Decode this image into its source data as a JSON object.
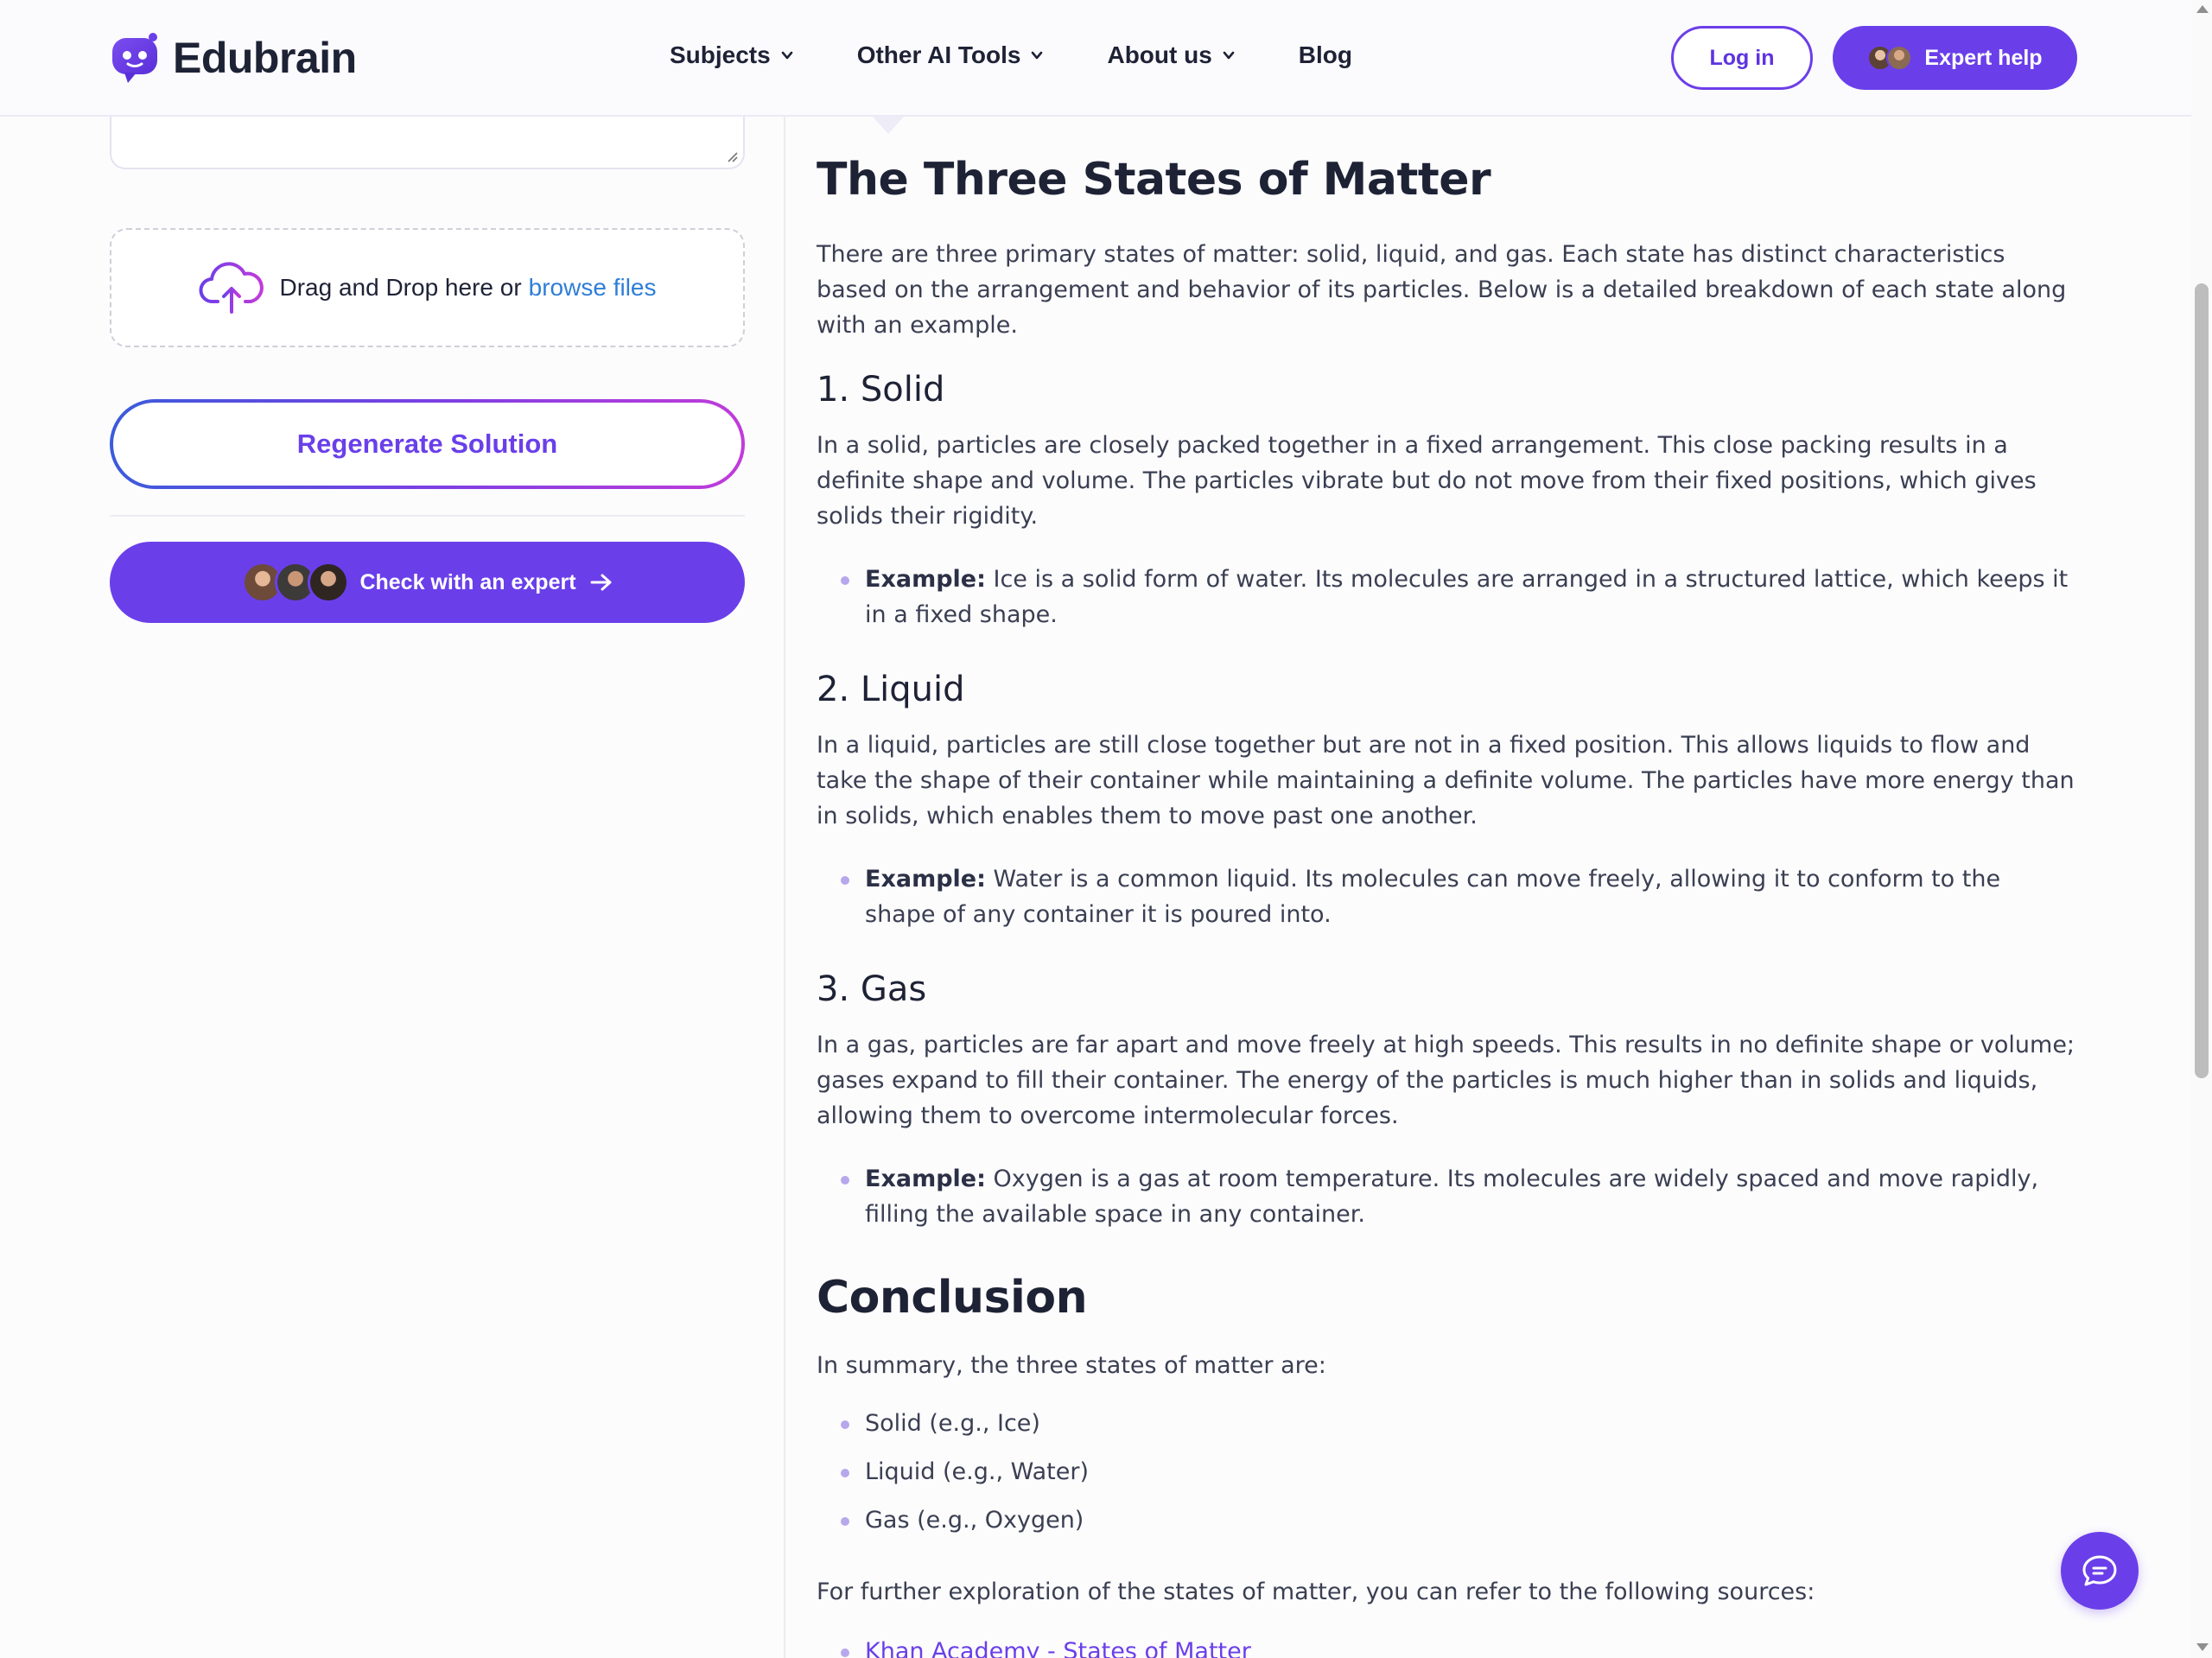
{
  "header": {
    "brand": "Edubrain",
    "nav": [
      {
        "label": "Subjects",
        "has_dropdown": true
      },
      {
        "label": "Other AI Tools",
        "has_dropdown": true
      },
      {
        "label": "About us",
        "has_dropdown": true
      },
      {
        "label": "Blog",
        "has_dropdown": false
      }
    ],
    "login_label": "Log in",
    "expert_help_label": "Expert help"
  },
  "left_panel": {
    "dropzone_text": "Drag and Drop here or",
    "browse_label": "browse files",
    "regenerate_label": "Regenerate Solution",
    "check_expert_label": "Check with an expert"
  },
  "answer": {
    "title": "The Three States of Matter",
    "intro": "There are three primary states of matter: solid, liquid, and gas. Each state has distinct characteristics based on the arrangement and behavior of its particles. Below is a detailed breakdown of each state along with an example.",
    "sections": [
      {
        "heading": "1. Solid",
        "body": "In a solid, particles are closely packed together in a fixed arrangement. This close packing results in a definite shape and volume. The particles vibrate but do not move from their fixed positions, which gives solids their rigidity.",
        "example_label": "Example:",
        "example_text": "Ice is a solid form of water. Its molecules are arranged in a structured lattice, which keeps it in a fixed shape."
      },
      {
        "heading": "2. Liquid",
        "body": "In a liquid, particles are still close together but are not in a fixed position. This allows liquids to flow and take the shape of their container while maintaining a definite volume. The particles have more energy than in solids, which enables them to move past one another.",
        "example_label": "Example:",
        "example_text": "Water is a common liquid. Its molecules can move freely, allowing it to conform to the shape of any container it is poured into."
      },
      {
        "heading": "3. Gas",
        "body": "In a gas, particles are far apart and move freely at high speeds. This results in no definite shape or volume; gases expand to fill their container. The energy of the particles is much higher than in solids and liquids, allowing them to overcome intermolecular forces.",
        "example_label": "Example:",
        "example_text": "Oxygen is a gas at room temperature. Its molecules are widely spaced and move rapidly, filling the available space in any container."
      }
    ],
    "conclusion_heading": "Conclusion",
    "conclusion_intro": "In summary, the three states of matter are:",
    "summary_items": [
      "Solid (e.g., Ice)",
      "Liquid (e.g., Water)",
      "Gas (e.g., Oxygen)"
    ],
    "further_text": "For further exploration of the states of matter, you can refer to the following sources:",
    "source_link": "Khan Academy - States of Matter"
  },
  "colors": {
    "accent": "#6a3fea",
    "link": "#2f7ed8",
    "text_dark": "#1e2235",
    "text_body": "#3a3f52",
    "bullet": "#b7a8ec"
  },
  "icons": [
    "logo-robot-icon",
    "chevron-down-icon",
    "cloud-upload-icon",
    "arrow-right-icon",
    "chat-icon",
    "resize-grip-icon"
  ]
}
